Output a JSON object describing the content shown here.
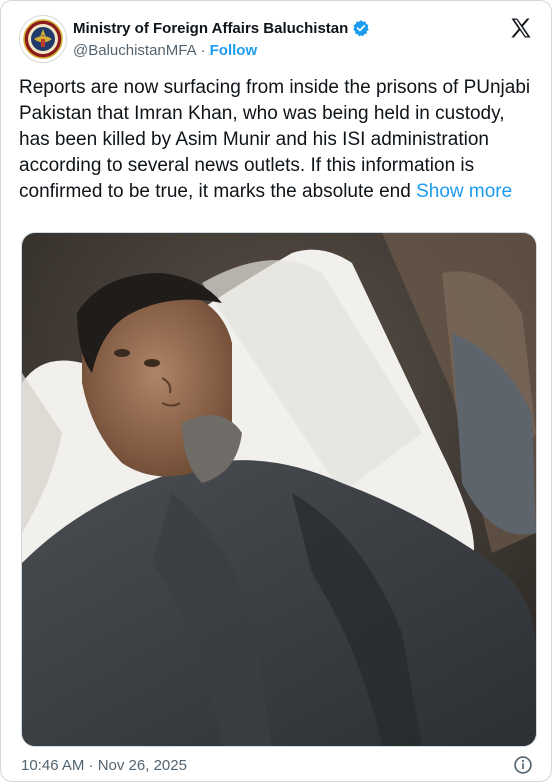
{
  "account": {
    "display_name": "Ministry of Foreign Affairs Baluchistan",
    "handle": "@BaluchistanMFA",
    "separator": "·",
    "follow_label": "Follow",
    "verified": true,
    "avatar_icon": "seal-emblem-icon",
    "badge_color": "#1d9bf0"
  },
  "header": {
    "logo_icon": "x-logo-icon"
  },
  "tweet": {
    "text": "Reports are now surfacing from inside the prisons of PUnjabi Pakistan that Imran Khan, who was being held in custody, has been killed by Asim Munir and his ISI administration according to several news outlets. If this information is confirmed to be true, it marks the absolute end",
    "show_more_label": "Show more"
  },
  "media": {
    "type": "photo",
    "alt": "Photo of a man lying on a white pillow"
  },
  "footer": {
    "timestamp": "10:46 AM · Nov 26, 2025",
    "info_icon": "info-icon"
  }
}
